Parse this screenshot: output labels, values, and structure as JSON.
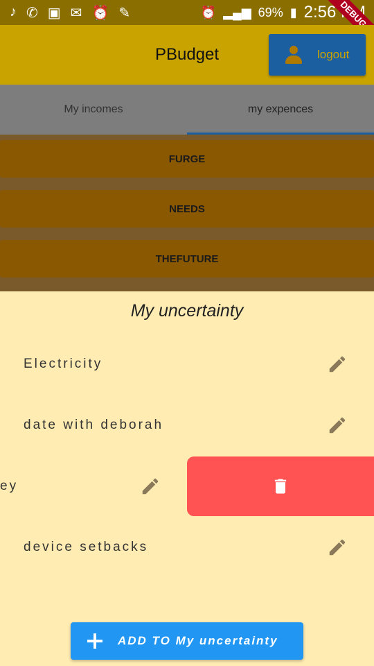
{
  "status_bar": {
    "battery": "69%",
    "time": "2:56 PM",
    "icons": [
      "music-icon",
      "whatsapp-icon",
      "image-icon",
      "mail-icon",
      "alarm-icon",
      "pen-icon",
      "alarm-icon",
      "signal-icon",
      "battery-icon"
    ],
    "debug_label": "DEBUG"
  },
  "app_bar": {
    "title": "PBudget",
    "logout_label": "logout"
  },
  "tabs": [
    {
      "label": "My incomes",
      "active": false
    },
    {
      "label": "my expences",
      "active": true
    }
  ],
  "categories": [
    "FURGE",
    "NEEDS",
    "THEFUTURE"
  ],
  "sheet": {
    "title": "My uncertainty",
    "items": [
      {
        "label": "Electricity"
      },
      {
        "label": "date with deborah"
      },
      {
        "label": "ey"
      },
      {
        "label": "device setbacks"
      }
    ],
    "add_label": "ADD TO My uncertainty"
  },
  "colors": {
    "delete": "#ff5252",
    "add_button": "#2196f3",
    "sheet_bg": "#ffecb3",
    "app_bar": "#c9a300"
  }
}
